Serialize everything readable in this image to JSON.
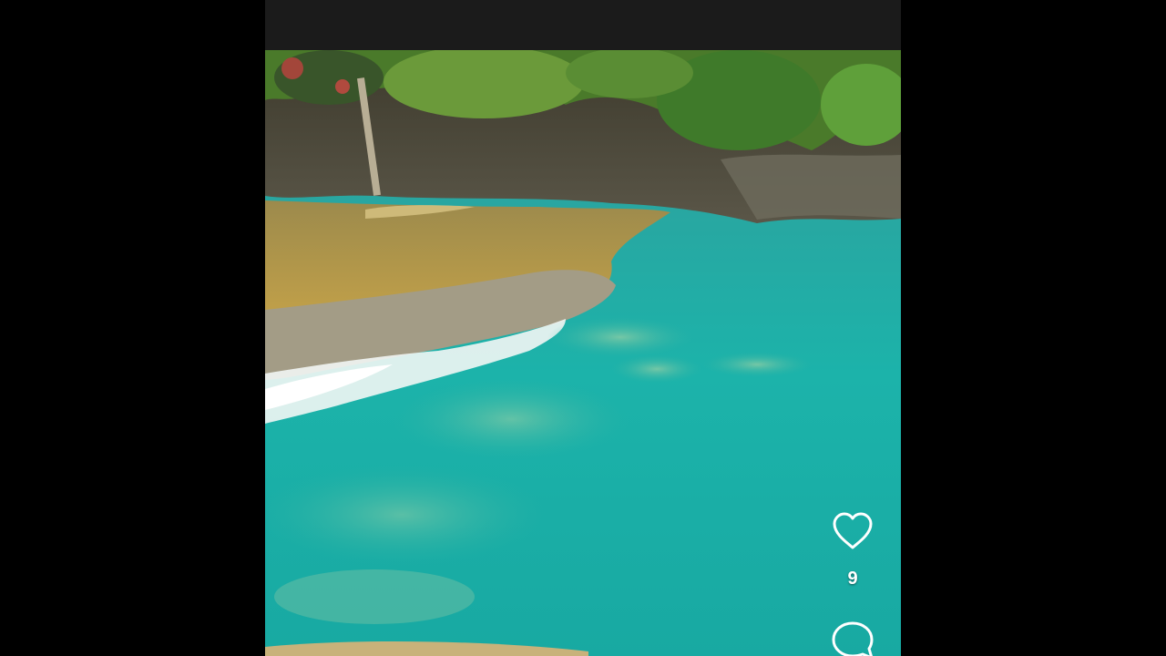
{
  "actions": {
    "like_icon": "heart-outline-icon",
    "like_count": "9",
    "comment_icon": "comment-bubble-icon"
  },
  "colors": {
    "background": "#000000",
    "water": "#1fb1a8",
    "terrace": "#b89a48",
    "foliage": "#4f7f2e",
    "icon": "#ffffff"
  }
}
